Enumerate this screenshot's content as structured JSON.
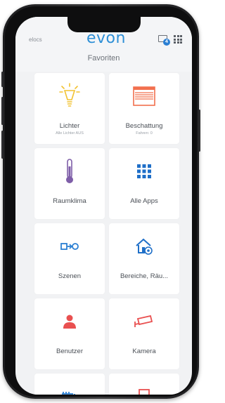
{
  "header": {
    "user_label": "elocs",
    "logo": "evon",
    "title": "Favoriten",
    "message_badge": "4"
  },
  "tiles": [
    {
      "label": "Lichter",
      "sub": "Alle Lichter AUS",
      "icon": "lightbulb-icon",
      "color": "#f2c230"
    },
    {
      "label": "Beschattung",
      "sub": "Fahren: 0",
      "icon": "blinds-icon",
      "color": "#f2704e"
    },
    {
      "label": "Raumklima",
      "sub": "",
      "icon": "thermometer-icon",
      "color": "#7e5ea8"
    },
    {
      "label": "Alle Apps",
      "sub": "",
      "icon": "apps-grid-icon",
      "color": "#1f6fc8"
    },
    {
      "label": "Szenen",
      "sub": "",
      "icon": "scene-icon",
      "color": "#2b7fd3"
    },
    {
      "label": "Bereiche, Räu...",
      "sub": "",
      "icon": "house-settings-icon",
      "color": "#1f6fc8"
    },
    {
      "label": "Benutzer",
      "sub": "",
      "icon": "user-icon",
      "color": "#e95050"
    },
    {
      "label": "Kamera",
      "sub": "",
      "icon": "camera-icon",
      "color": "#e95050"
    },
    {
      "label": "",
      "sub": "",
      "icon": "stairs-icon",
      "color": "#2b7fd3"
    },
    {
      "label": "",
      "sub": "",
      "icon": "door-icon",
      "color": "#e95050"
    }
  ]
}
